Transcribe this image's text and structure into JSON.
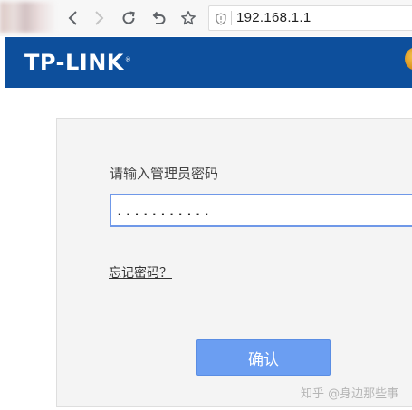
{
  "browser": {
    "url": "192.168.1.1",
    "icons": [
      "back-icon",
      "forward-icon",
      "reload-icon",
      "home-icon",
      "star-icon",
      "shield-icon"
    ]
  },
  "brand": {
    "logo_text": "TP-LINK",
    "logo_mark": "®",
    "bar_color": "#0d4f9c"
  },
  "login": {
    "prompt": "请输入管理员密码",
    "password_value": "...........",
    "forgot_link": "忘记密码？",
    "confirm_label": "确认",
    "accent_color": "#6b9ef2"
  },
  "watermark": "知乎 @身边那些事"
}
